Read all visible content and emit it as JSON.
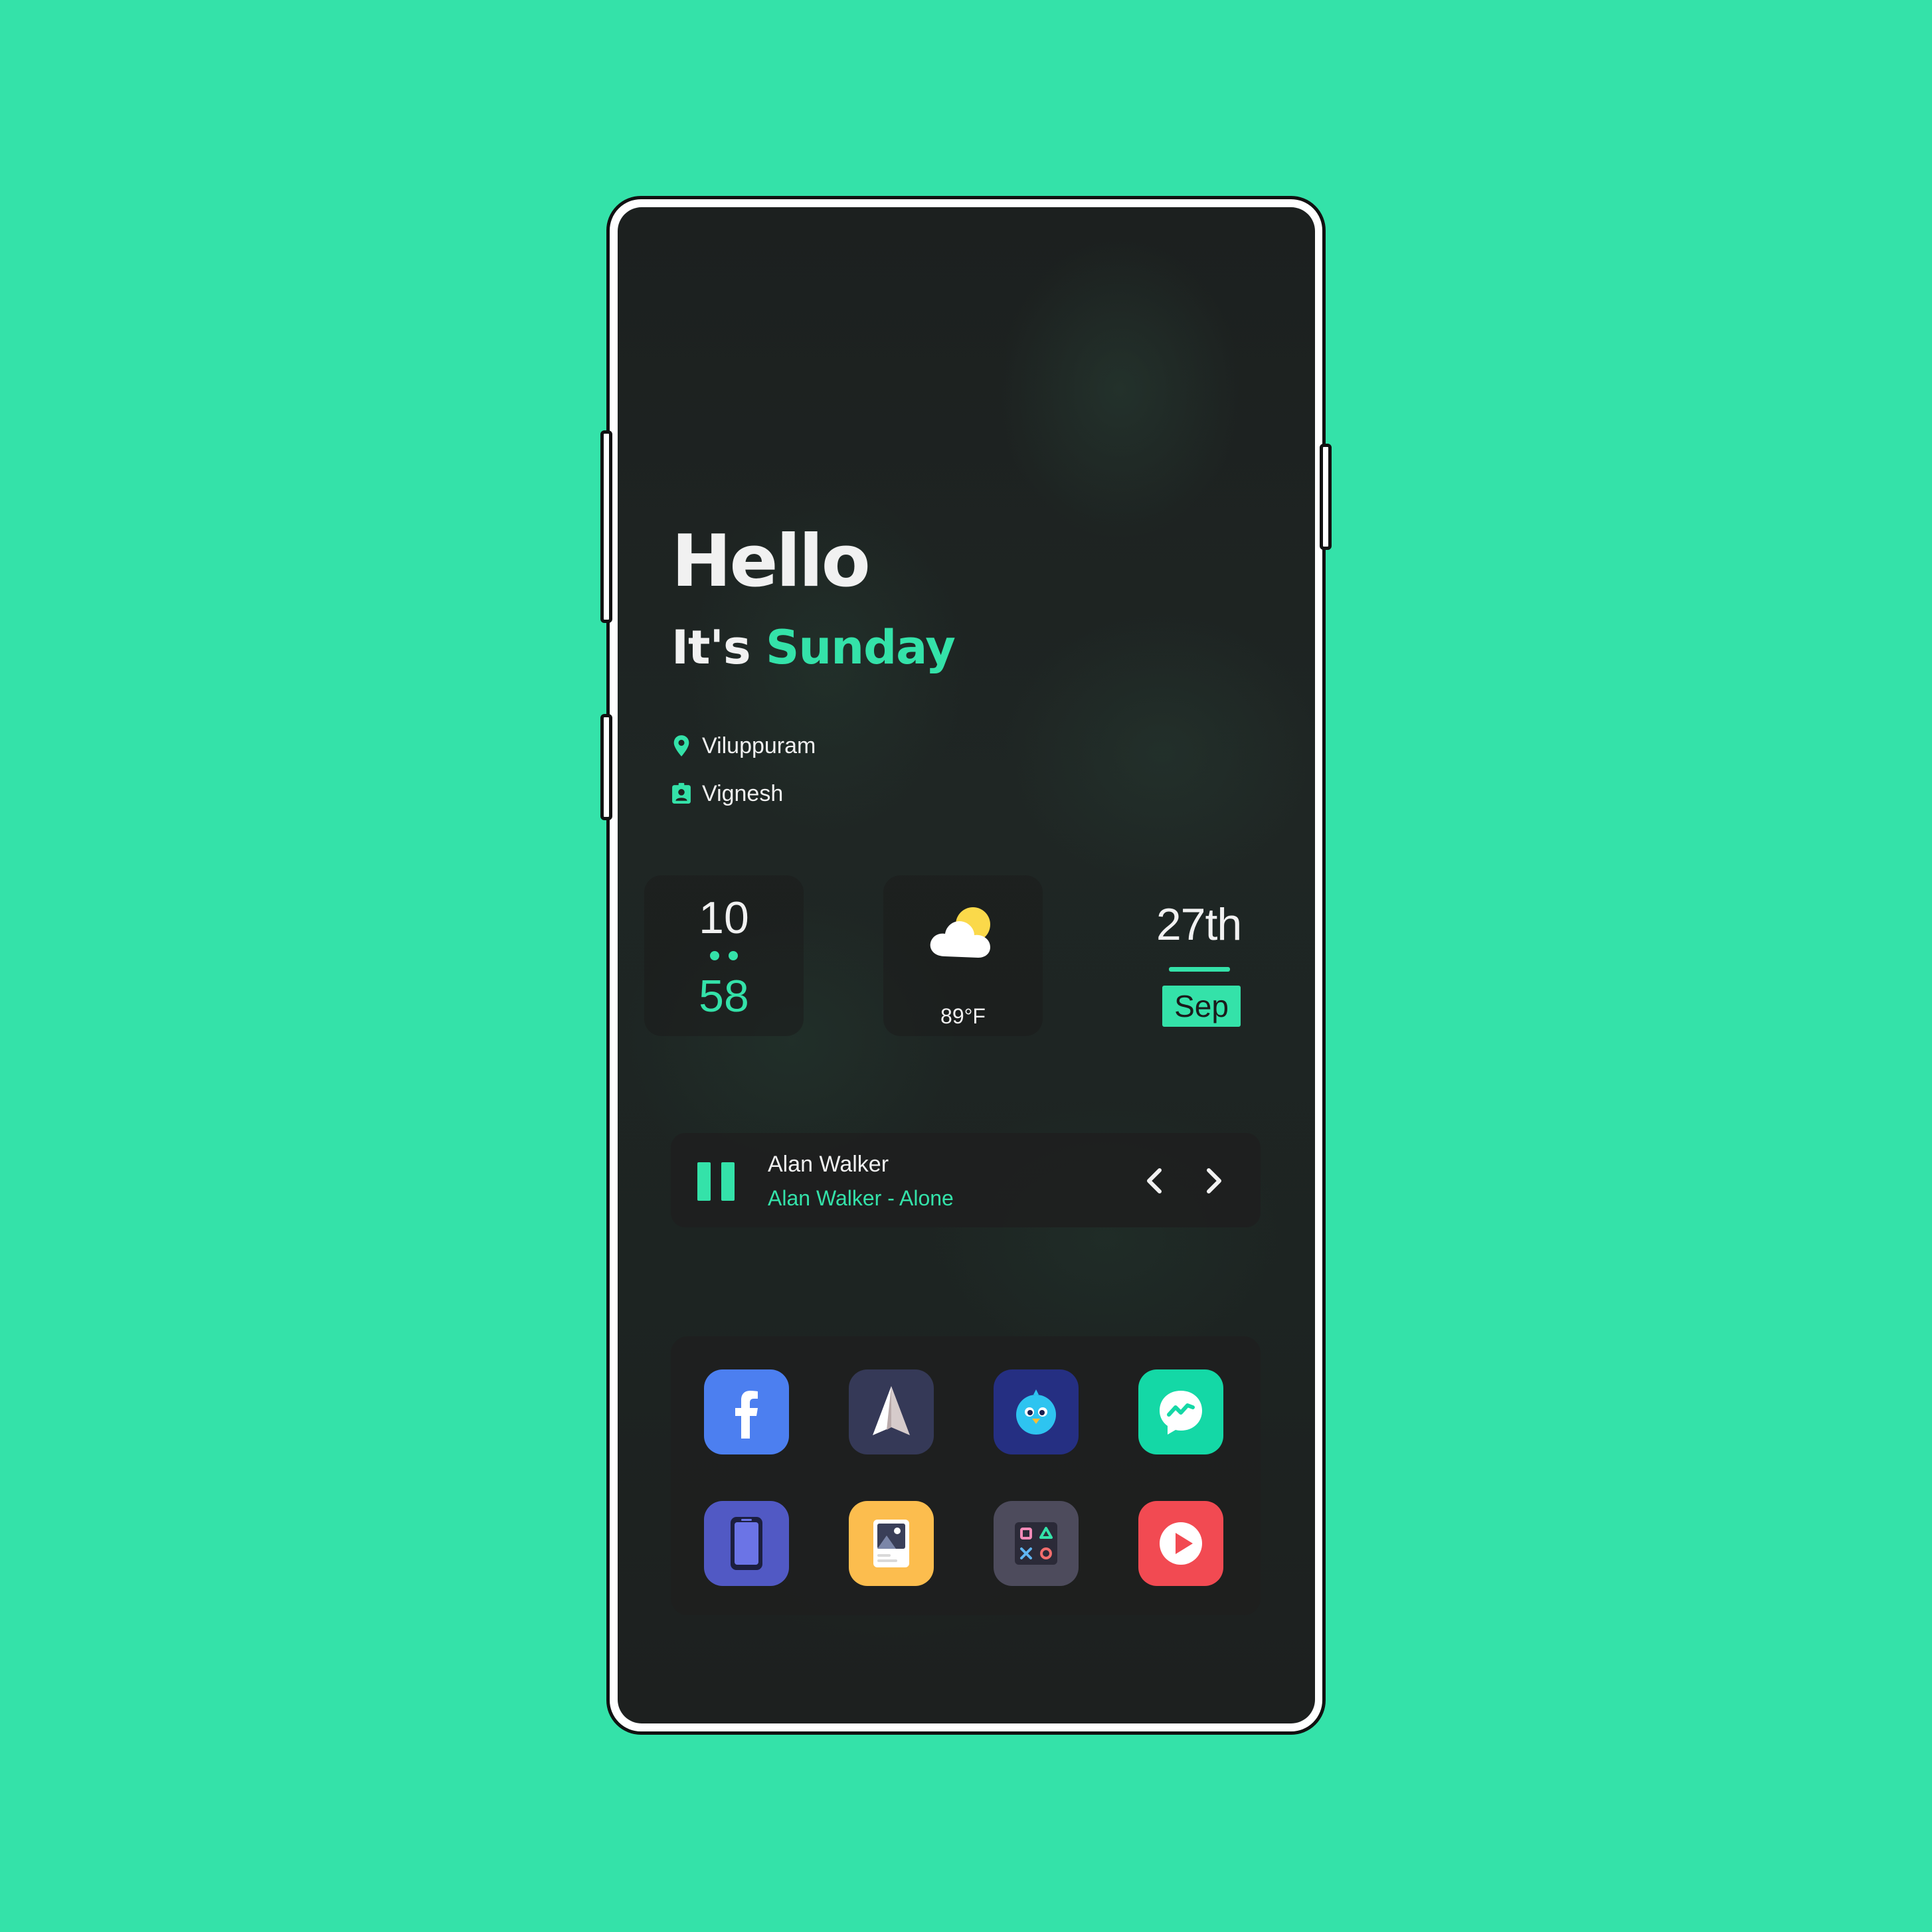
{
  "greeting": {
    "hello": "Hello",
    "day_prefix": "It's",
    "day_name": "Sunday"
  },
  "info": {
    "location": "Viluppuram",
    "user": "Vignesh"
  },
  "clock": {
    "hour": "10",
    "minute": "58"
  },
  "weather": {
    "temperature": "89°F",
    "condition_icon": "partly-cloudy-icon"
  },
  "date": {
    "day": "27th",
    "month": "Sep"
  },
  "music": {
    "artist": "Alan Walker",
    "title": "Alan Walker - Alone",
    "state": "playing"
  },
  "apps": [
    {
      "name": "facebook",
      "icon": "facebook-icon",
      "color": "#4c7ff0"
    },
    {
      "name": "paper-plane",
      "icon": "paper-plane-icon",
      "color": "#353957"
    },
    {
      "name": "twitter-bird",
      "icon": "bird-icon",
      "color": "#252f82"
    },
    {
      "name": "messenger",
      "icon": "messenger-icon",
      "color": "#14d8a6"
    },
    {
      "name": "phone",
      "icon": "phone-icon",
      "color": "#5159c4"
    },
    {
      "name": "gallery",
      "icon": "gallery-icon",
      "color": "#fcbd4e"
    },
    {
      "name": "games",
      "icon": "gamepad-icon",
      "color": "#4d4b5c"
    },
    {
      "name": "video-player",
      "icon": "play-icon",
      "color": "#f24a52"
    }
  ],
  "colors": {
    "accent": "#34e2a9",
    "background": "#34e2a9",
    "text": "#f1f1f1"
  }
}
